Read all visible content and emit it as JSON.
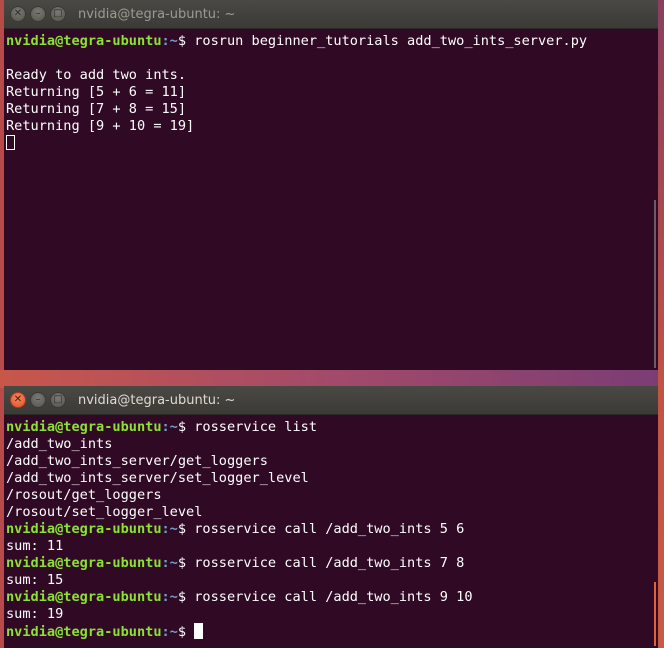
{
  "top_window": {
    "title": "nvidia@tegra-ubuntu: ~",
    "lines": [
      {
        "type": "prompt",
        "user": "nvidia@tegra-ubuntu",
        "path": ":~",
        "symbol": "$ ",
        "command": "rosrun beginner_tutorials add_two_ints_server.py"
      },
      {
        "type": "output",
        "text": ""
      },
      {
        "type": "output",
        "text": "Ready to add two ints."
      },
      {
        "type": "output",
        "text": "Returning [5 + 6 = 11]"
      },
      {
        "type": "output",
        "text": "Returning [7 + 8 = 15]"
      },
      {
        "type": "output",
        "text": "Returning [9 + 10 = 19]"
      }
    ]
  },
  "bottom_window": {
    "title": "nvidia@tegra-ubuntu: ~",
    "lines": [
      {
        "type": "prompt",
        "user": "nvidia@tegra-ubuntu",
        "path": ":~",
        "symbol": "$ ",
        "command": "rosservice list"
      },
      {
        "type": "output",
        "text": "/add_two_ints"
      },
      {
        "type": "output",
        "text": "/add_two_ints_server/get_loggers"
      },
      {
        "type": "output",
        "text": "/add_two_ints_server/set_logger_level"
      },
      {
        "type": "output",
        "text": "/rosout/get_loggers"
      },
      {
        "type": "output",
        "text": "/rosout/set_logger_level"
      },
      {
        "type": "prompt",
        "user": "nvidia@tegra-ubuntu",
        "path": ":~",
        "symbol": "$ ",
        "command": "rosservice call /add_two_ints 5 6"
      },
      {
        "type": "output",
        "text": "sum: 11"
      },
      {
        "type": "prompt",
        "user": "nvidia@tegra-ubuntu",
        "path": ":~",
        "symbol": "$ ",
        "command": "rosservice call /add_two_ints 7 8"
      },
      {
        "type": "output",
        "text": "sum: 15"
      },
      {
        "type": "prompt",
        "user": "nvidia@tegra-ubuntu",
        "path": ":~",
        "symbol": "$ ",
        "command": "rosservice call /add_two_ints 9 10"
      },
      {
        "type": "output",
        "text": "sum: 19"
      },
      {
        "type": "prompt",
        "user": "nvidia@tegra-ubuntu",
        "path": ":~",
        "symbol": "$ ",
        "command": ""
      }
    ]
  },
  "buttons": {
    "close_glyph": "✕",
    "minimize_glyph": "–",
    "maximize_glyph": "□"
  },
  "colors": {
    "terminal_bg": "#300a24",
    "prompt_user": "#8ae234",
    "prompt_path": "#729fcf",
    "text": "#ffffff"
  }
}
